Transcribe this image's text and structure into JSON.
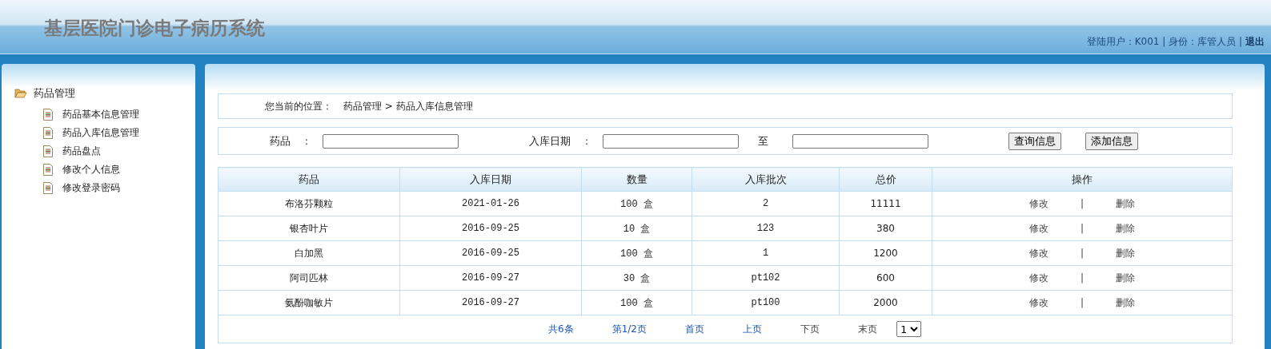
{
  "header": {
    "title": "基层医院门诊电子病历系统",
    "user_info": "登陆用户：K001 | 身份：库管人员 |",
    "logout": "退出"
  },
  "sidebar": {
    "group": {
      "label": "药品管理",
      "expanded": true,
      "children": [
        {
          "label": "药品基本信息管理"
        },
        {
          "label": "药品入库信息管理"
        },
        {
          "label": "药品盘点"
        },
        {
          "label": "修改个人信息"
        },
        {
          "label": "修改登录密码"
        }
      ]
    }
  },
  "breadcrumb": {
    "label": "您当前的位置：",
    "path": "药品管理 > 药品入库信息管理"
  },
  "search": {
    "fields": [
      {
        "label": "药品",
        "separator": ":"
      },
      {
        "label": "入库日期",
        "separator": ":"
      },
      {
        "label": "至"
      }
    ],
    "buttons": [
      "查询信息",
      "添加信息"
    ]
  },
  "table": {
    "columns": [
      "药品",
      "入库日期",
      "数量",
      "入库批次",
      "总价",
      "操作"
    ],
    "rows": [
      {
        "cells": [
          "布洛芬颗粒",
          "2021-01-26",
          "100 盒",
          "2",
          "11111"
        ],
        "actions": [
          "修改",
          "|",
          "删除"
        ]
      },
      {
        "cells": [
          "银杏叶片",
          "2016-09-25",
          "10 盒",
          "123",
          "380"
        ],
        "actions": [
          "修改",
          "|",
          "删除"
        ]
      },
      {
        "cells": [
          "白加黑",
          "2016-09-25",
          "100 盒",
          "1",
          "1200"
        ],
        "actions": [
          "修改",
          "|",
          "删除"
        ]
      },
      {
        "cells": [
          "阿司匹林",
          "2016-09-27",
          "30 盒",
          "pt102",
          "600"
        ],
        "actions": [
          "修改",
          "|",
          "删除"
        ]
      },
      {
        "cells": [
          "氨酚咖敏片",
          "2016-09-27",
          "100 盒",
          "pt100",
          "2000"
        ],
        "actions": [
          "修改",
          "|",
          "删除"
        ]
      }
    ]
  },
  "pager": {
    "items": [
      {
        "label": "共6条",
        "disabled": false
      },
      {
        "label": "第1/2页",
        "disabled": false
      },
      {
        "label": "首页",
        "disabled": false
      },
      {
        "label": "上页",
        "disabled": false
      },
      {
        "label": "下页",
        "disabled": true
      },
      {
        "label": "末页",
        "disabled": true
      }
    ],
    "page_select": "1"
  }
}
